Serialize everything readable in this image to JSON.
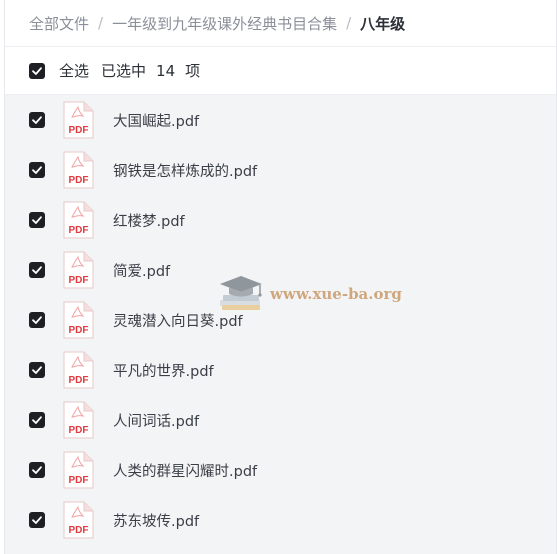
{
  "breadcrumb": {
    "items": [
      "全部文件",
      "一年级到九年级课外经典书目合集",
      "八年级"
    ],
    "separator": "/"
  },
  "selection": {
    "select_all_label": "全选",
    "selected_text": "已选中",
    "count": "14",
    "unit": "项",
    "checked": true
  },
  "files": [
    {
      "name": "大国崛起.pdf",
      "icon": "pdf-icon",
      "checked": true
    },
    {
      "name": "钢铁是怎样炼成的.pdf",
      "icon": "pdf-icon",
      "checked": true
    },
    {
      "name": "红楼梦.pdf",
      "icon": "pdf-icon",
      "checked": true
    },
    {
      "name": "简爱.pdf",
      "icon": "pdf-icon",
      "checked": true
    },
    {
      "name": "灵魂潜入向日葵.pdf",
      "icon": "pdf-icon",
      "checked": true
    },
    {
      "name": "平凡的世界.pdf",
      "icon": "pdf-icon",
      "checked": true
    },
    {
      "name": "人间词话.pdf",
      "icon": "pdf-icon",
      "checked": true
    },
    {
      "name": "人类的群星闪耀时.pdf",
      "icon": "pdf-icon",
      "checked": true
    },
    {
      "name": "苏东坡传.pdf",
      "icon": "pdf-icon",
      "checked": true
    }
  ],
  "watermark": {
    "text": "www.xue-ba.org",
    "icon": "graduation-cap-books-logo"
  },
  "colors": {
    "checkbox": "#1d1f24",
    "pdf_red": "#e0393e",
    "list_bg": "#f3f4f6",
    "watermark": "#c99a6a"
  }
}
